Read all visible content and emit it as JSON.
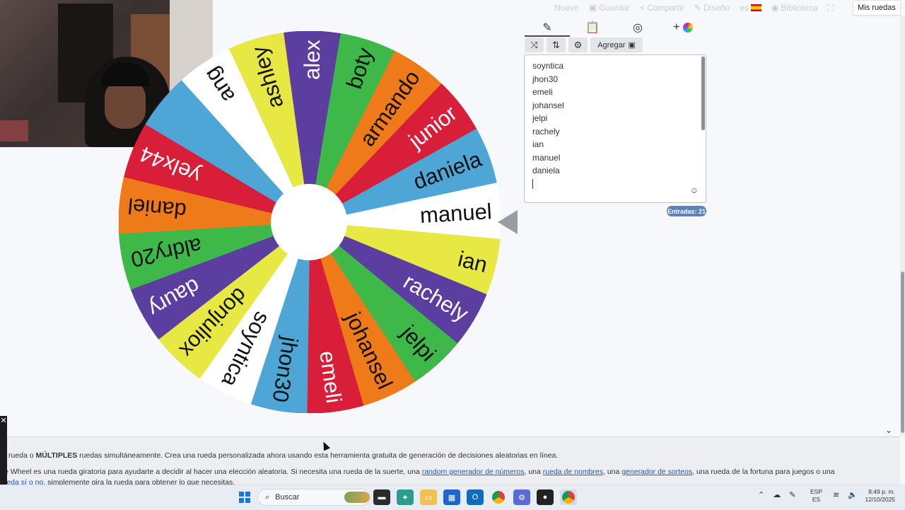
{
  "topnav": {
    "items": [
      {
        "label": "Nuevo",
        "icon": "new-icon"
      },
      {
        "label": "Guardar",
        "icon": "save-icon"
      },
      {
        "label": "Compartir",
        "icon": "share-icon"
      },
      {
        "label": "Diseño",
        "icon": "brush-icon"
      },
      {
        "label": "es",
        "icon": "spain-flag-icon"
      },
      {
        "label": "Biblioteca",
        "icon": "globe-icon"
      }
    ],
    "mis_ruedas": "Mis ruedas"
  },
  "wheel": {
    "slices": [
      {
        "label": "manuel",
        "color": "#ffffff",
        "text": "#111111"
      },
      {
        "label": "ian",
        "color": "#e8e845",
        "text": "#111111"
      },
      {
        "label": "rachely",
        "color": "#5b3ea0",
        "text": "#ffffff"
      },
      {
        "label": "jelpi",
        "color": "#3fb84a",
        "text": "#111111"
      },
      {
        "label": "johansel",
        "color": "#ef7a1a",
        "text": "#111111"
      },
      {
        "label": "emeli",
        "color": "#d81e38",
        "text": "#ffffff"
      },
      {
        "label": "jhon30",
        "color": "#4da6d6",
        "text": "#111111"
      },
      {
        "label": "soyntica",
        "color": "#ffffff",
        "text": "#111111"
      },
      {
        "label": "donjuliox",
        "color": "#e8e845",
        "text": "#111111"
      },
      {
        "label": "daury",
        "color": "#5b3ea0",
        "text": "#ffffff"
      },
      {
        "label": "aldry20",
        "color": "#3fb84a",
        "text": "#111111"
      },
      {
        "label": "daniel",
        "color": "#ef7a1a",
        "text": "#111111"
      },
      {
        "label": "yelx44",
        "color": "#d81e38",
        "text": "#ffffff"
      },
      {
        "label": "",
        "color": "#4da6d6",
        "text": "#111111"
      },
      {
        "label": "ang",
        "color": "#ffffff",
        "text": "#111111"
      },
      {
        "label": "ashley",
        "color": "#e8e845",
        "text": "#111111"
      },
      {
        "label": "alex",
        "color": "#5b3ea0",
        "text": "#ffffff"
      },
      {
        "label": "boty",
        "color": "#3fb84a",
        "text": "#111111"
      },
      {
        "label": "armando",
        "color": "#ef7a1a",
        "text": "#111111"
      },
      {
        "label": "junior",
        "color": "#d81e38",
        "text": "#ffffff"
      },
      {
        "label": "daniela",
        "color": "#4da6d6",
        "text": "#111111"
      }
    ]
  },
  "panel": {
    "add_button": "Agregar",
    "entries": [
      "soyntica",
      "jhon30",
      "emeli",
      "johansel",
      "jelpi",
      "rachely",
      "ian",
      "manuel",
      "daniela"
    ],
    "count_badge": "Entradas: 21"
  },
  "description": {
    "line1_prefix": "rueda o ",
    "line1_bold": "MÚLTIPLES",
    "line1_rest": " ruedas simultáneamente. Crea una rueda personalizada ahora usando esta herramienta gratuita de generación de decisiones aleatorias en línea.",
    "line2_prefix": "e Wheel es una rueda giratoria para ayudarte a decidir al hacer una elección aleatoria. Si necesita una rueda de la suerte, una ",
    "link1": "random generador de números",
    "sep1": ", una ",
    "link2": "rueda de nombres",
    "sep2": ", una ",
    "link3": "generador de sorteos",
    "line2_suffix": ", una rueda de la fortuna para juegos o una",
    "link4": "rueda sí o no",
    "line3_suffix": ", simplemente gira la rueda para obtener lo que necesitas."
  },
  "taskbar": {
    "search_placeholder": "Buscar",
    "lang_top": "ESP",
    "lang_bottom": "ES",
    "time": "8:49 p. m.",
    "date": "12/10/2025"
  }
}
